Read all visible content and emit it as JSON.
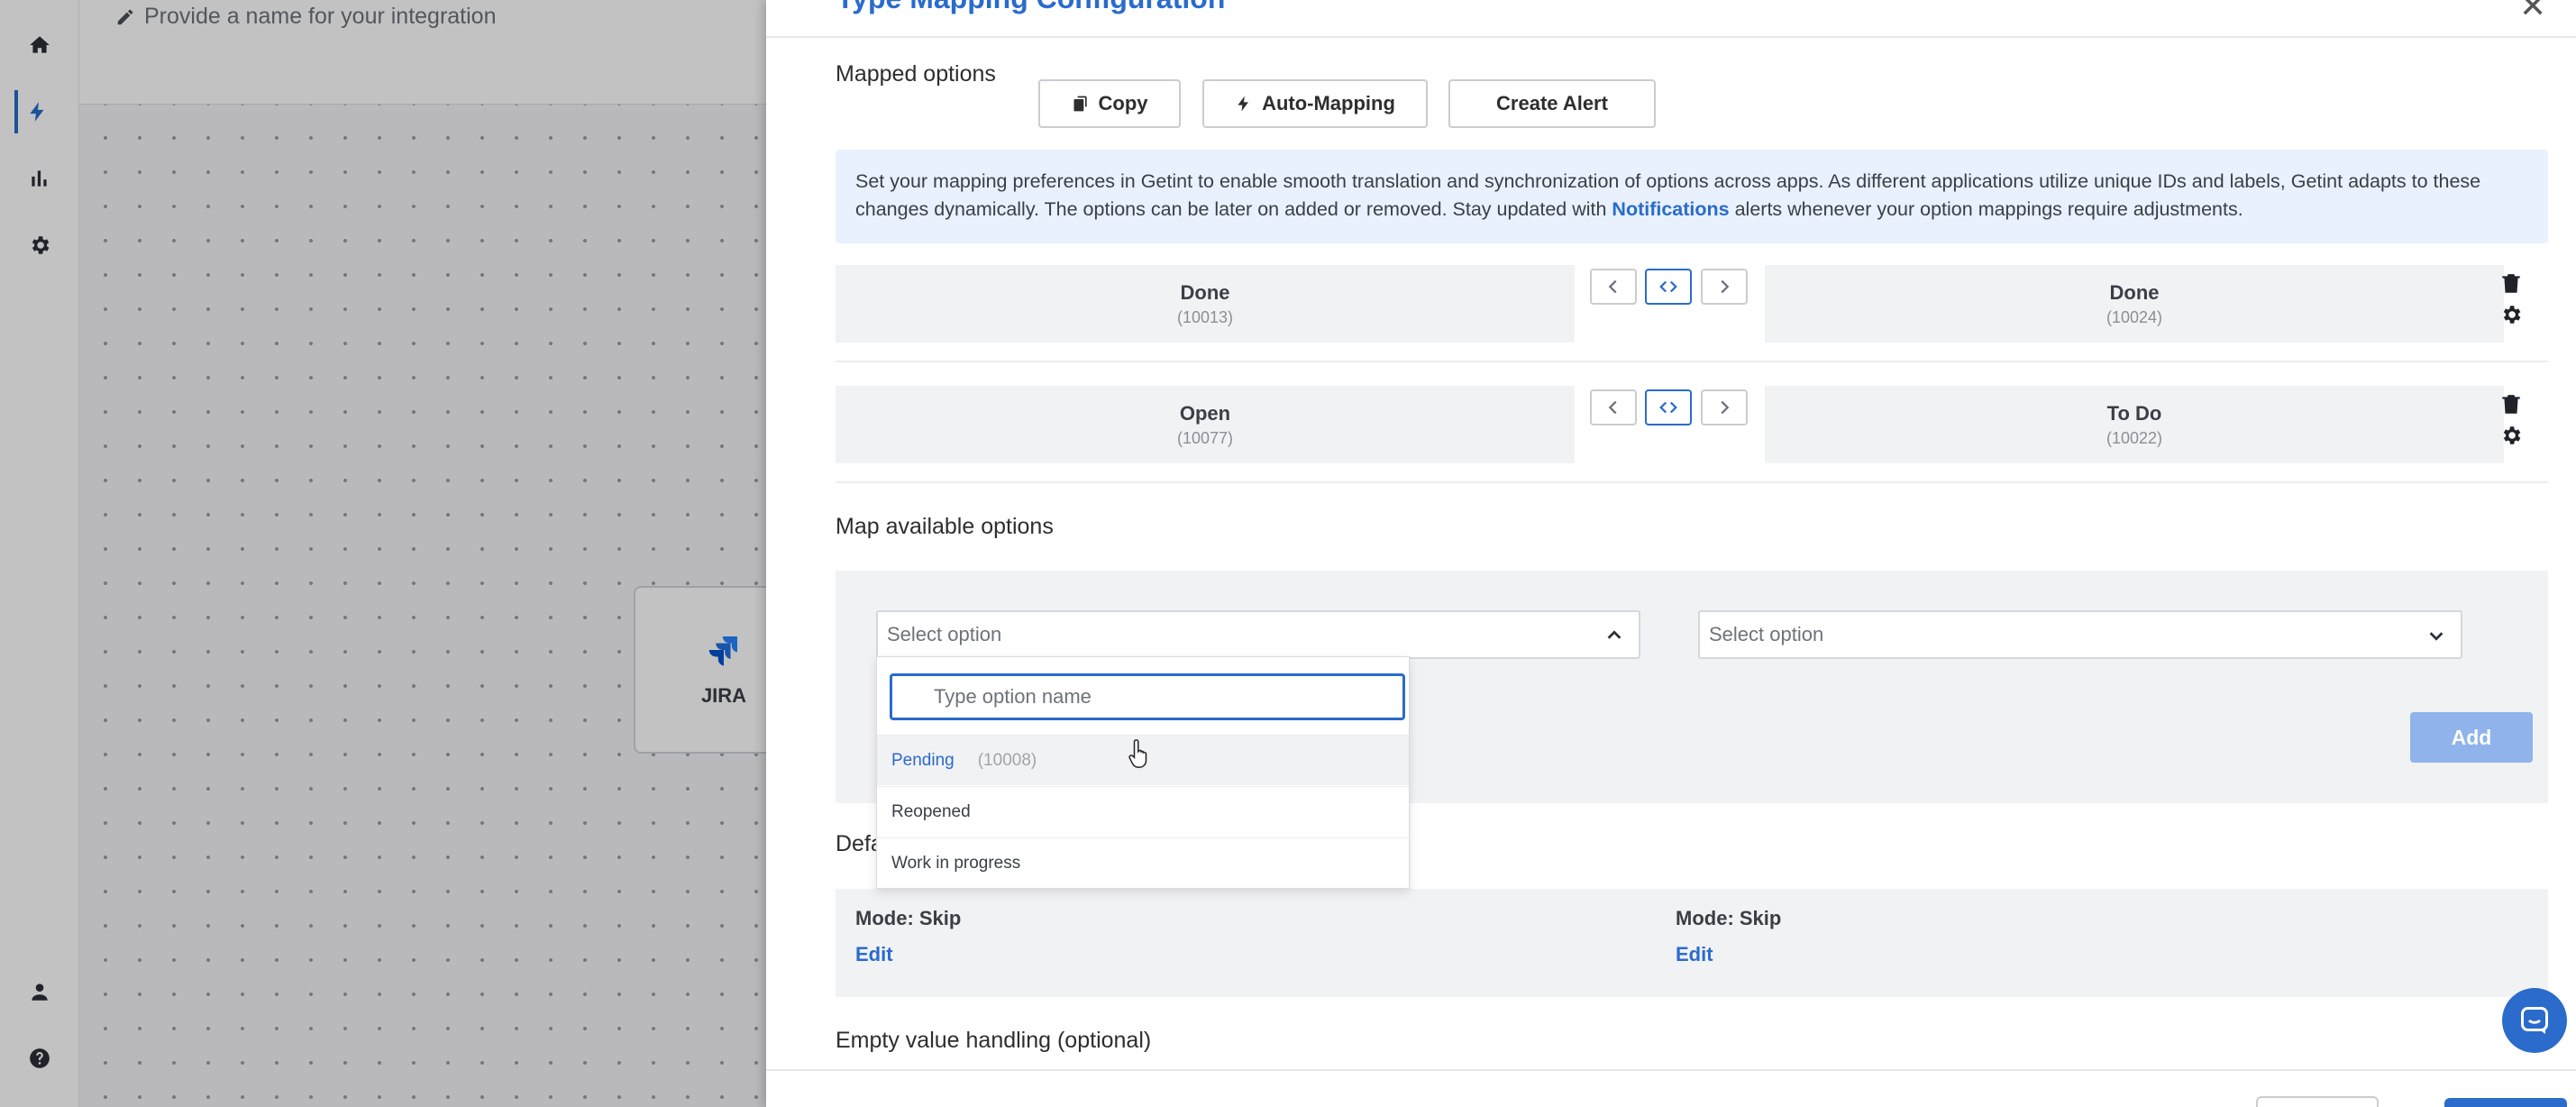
{
  "app": {
    "integration_name_placeholder": "Provide a name for your integration",
    "node_label": "JIRA"
  },
  "modal": {
    "title": "Type Mapping Configuration",
    "mapped_options_label": "Mapped options",
    "toolbar": {
      "copy_label": "Copy",
      "automap_label": "Auto-Mapping",
      "alert_label": "Create Alert"
    },
    "info": {
      "text_before": "Set your mapping preferences in Getint to enable smooth translation and synchronization of options across apps. As different applications utilize unique IDs and labels, Getint adapts to these changes dynamically. The options can be later on added or removed. Stay updated with ",
      "link": "Notifications",
      "text_after": " alerts whenever your option mappings require adjustments."
    },
    "mappings": [
      {
        "left_name": "Done",
        "left_id": "(10013)",
        "right_name": "Done",
        "right_id": "(10024)"
      },
      {
        "left_name": "Open",
        "left_id": "(10077)",
        "right_name": "To Do",
        "right_id": "(10022)"
      }
    ],
    "available": {
      "label": "Map available options",
      "left_select": "Select option",
      "right_select": "Select option",
      "add_label": "Add",
      "search_placeholder": "Type option name",
      "options": [
        {
          "label": "Pending",
          "id": "(10008)"
        },
        {
          "label": "Reopened",
          "id": ""
        },
        {
          "label": "Work in progress",
          "id": ""
        }
      ]
    },
    "defaults": {
      "label_visible": "Defa",
      "left_mode": "Mode: Skip",
      "left_edit": "Edit",
      "right_mode": "Mode: Skip",
      "right_edit": "Edit"
    },
    "empty_value_label": "Empty value handling (optional)"
  },
  "colors": {
    "accent": "#2a6bcc",
    "info_bg": "#e8f1fd",
    "add_disabled": "#8fb3ea"
  }
}
